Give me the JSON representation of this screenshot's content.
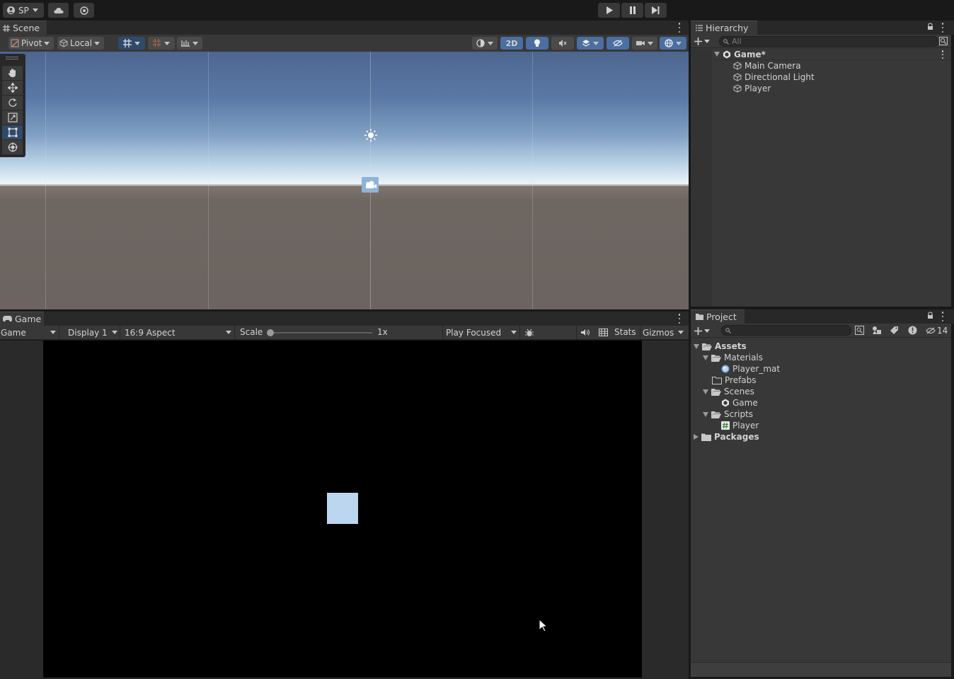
{
  "toolbar": {
    "account_label": "SP",
    "play_icon": "play-icon",
    "pause_icon": "pause-icon",
    "step_icon": "step-icon"
  },
  "scene": {
    "tab_label": "Scene",
    "pivot_label": "Pivot",
    "local_label": "Local",
    "mode_2d_label": "2D"
  },
  "game": {
    "tab_label": "Game",
    "view_select": "Game",
    "display_select": "Display 1",
    "aspect_select": "16:9 Aspect",
    "scale_label": "Scale",
    "scale_value": "1x",
    "play_mode_select": "Play Focused",
    "stats_label": "Stats",
    "gizmos_label": "Gizmos"
  },
  "hierarchy": {
    "tab_label": "Hierarchy",
    "search_placeholder": "All",
    "scene_name": "Game*",
    "items": [
      "Main Camera",
      "Directional Light",
      "Player"
    ]
  },
  "project": {
    "tab_label": "Project",
    "search_placeholder": "",
    "hidden_count": "14",
    "tree": {
      "assets": "Assets",
      "materials": "Materials",
      "player_mat": "Player_mat",
      "prefabs": "Prefabs",
      "scenes": "Scenes",
      "game_scene": "Game",
      "scripts": "Scripts",
      "player_script": "Player",
      "packages": "Packages"
    }
  },
  "colors": {
    "editor_bg": "#191919",
    "panel_bg": "#383838",
    "accent_blue": "#4a6fa0",
    "player_square": "#bcd6ef"
  }
}
